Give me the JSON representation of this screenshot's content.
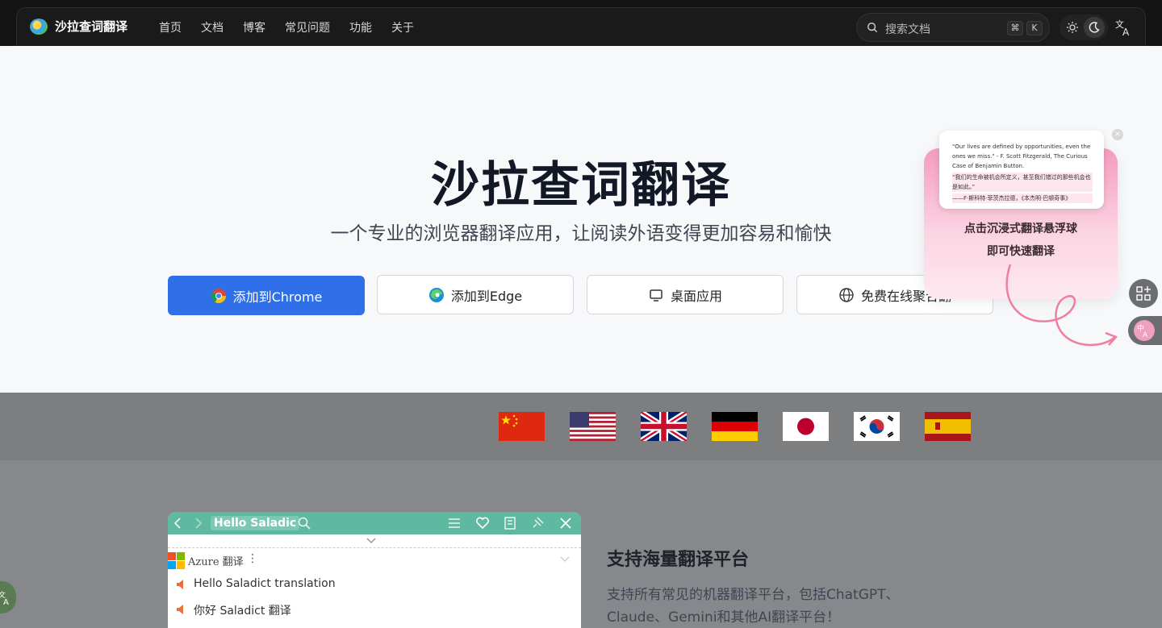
{
  "nav": {
    "brand": "沙拉查词翻译",
    "menu": [
      "首页",
      "文档",
      "博客",
      "常见问题",
      "功能",
      "关于"
    ],
    "search_placeholder": "搜索文档",
    "kbd_cmd": "⌘",
    "kbd_k": "K"
  },
  "hero": {
    "title": "沙拉查词翻译",
    "subtitle": "一个专业的浏览器翻译应用，让阅读外语变得更加容易和愉快",
    "buttons": {
      "chrome": "添加到Chrome",
      "edge": "添加到Edge",
      "desktop": "桌面应用",
      "online": "免费在线聚合翻"
    }
  },
  "promo": {
    "quote_en": "\"Our lives are defined by opportunities, even the ones we miss.\" - F. Scott Fitzgerald, The Curious Case of Benjamin Button.",
    "quote_zh": "“我们的生命被机会所定义，甚至我们错过的那些机会也是如此。”",
    "quote_src": "——F·斯科特·菲茨杰拉德，《本杰明·巴顿奇事》",
    "close": "×",
    "line1": "点击沉浸式翻译悬浮球",
    "line2": "即可快速翻译"
  },
  "flags": [
    "china",
    "usa",
    "uk",
    "germany",
    "japan",
    "korea",
    "spain"
  ],
  "feature": {
    "panel_title": "Hello Saladic",
    "engine": "Azure 翻译",
    "dots": "⋮",
    "result_en": "Hello Saladict translation",
    "result_zh": "你好 Saladict 翻译",
    "heading": "支持海量翻译平台",
    "desc": "支持所有常见的机器翻译平台，包括ChatGPT、Claude、Gemini和其他AI翻译平台！"
  },
  "colors": {
    "primary": "#2f6fe8",
    "panel_header": "#5fb9a0",
    "promo_pink": "#f59bbe"
  }
}
